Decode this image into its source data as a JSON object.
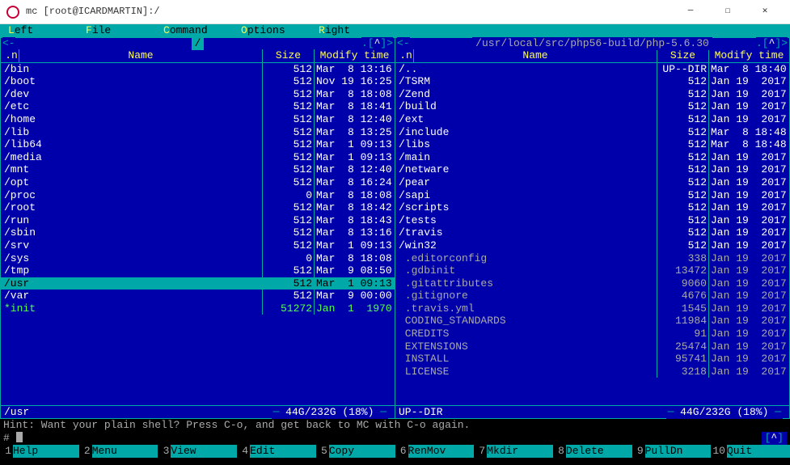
{
  "window": {
    "title": "mc [root@ICARDMARTIN]:/"
  },
  "menubar": {
    "items": [
      {
        "hotkey": "L",
        "rest": "eft"
      },
      {
        "hotkey": "F",
        "rest": "ile"
      },
      {
        "hotkey": "C",
        "rest": "ommand"
      },
      {
        "hotkey": "O",
        "rest": "ptions"
      },
      {
        "hotkey": "R",
        "rest": "ight"
      }
    ]
  },
  "left_panel": {
    "path": " / ",
    "corner_left": "<-",
    "corner_right_pre": ".[",
    "corner_right_caret": "^",
    "corner_right_post": "]>",
    "columns": {
      "dot": ".n",
      "name": "Name",
      "size": "Size",
      "mtime": "Modify time"
    },
    "rows": [
      {
        "name": "/bin",
        "size": "512",
        "date": "Mar  8 13:16",
        "type": "dir"
      },
      {
        "name": "/boot",
        "size": "512",
        "date": "Nov 19 16:25",
        "type": "dir"
      },
      {
        "name": "/dev",
        "size": "512",
        "date": "Mar  8 18:08",
        "type": "dir"
      },
      {
        "name": "/etc",
        "size": "512",
        "date": "Mar  8 18:41",
        "type": "dir"
      },
      {
        "name": "/home",
        "size": "512",
        "date": "Mar  8 12:40",
        "type": "dir"
      },
      {
        "name": "/lib",
        "size": "512",
        "date": "Mar  8 13:25",
        "type": "dir"
      },
      {
        "name": "/lib64",
        "size": "512",
        "date": "Mar  1 09:13",
        "type": "dir"
      },
      {
        "name": "/media",
        "size": "512",
        "date": "Mar  1 09:13",
        "type": "dir"
      },
      {
        "name": "/mnt",
        "size": "512",
        "date": "Mar  8 12:40",
        "type": "dir"
      },
      {
        "name": "/opt",
        "size": "512",
        "date": "Mar  8 16:24",
        "type": "dir"
      },
      {
        "name": "/proc",
        "size": "0",
        "date": "Mar  8 18:08",
        "type": "dir"
      },
      {
        "name": "/root",
        "size": "512",
        "date": "Mar  8 18:42",
        "type": "dir"
      },
      {
        "name": "/run",
        "size": "512",
        "date": "Mar  8 18:43",
        "type": "dir"
      },
      {
        "name": "/sbin",
        "size": "512",
        "date": "Mar  8 13:16",
        "type": "dir"
      },
      {
        "name": "/srv",
        "size": "512",
        "date": "Mar  1 09:13",
        "type": "dir"
      },
      {
        "name": "/sys",
        "size": "0",
        "date": "Mar  8 18:08",
        "type": "dir"
      },
      {
        "name": "/tmp",
        "size": "512",
        "date": "Mar  9 08:50",
        "type": "dir"
      },
      {
        "name": "/usr",
        "size": "512",
        "date": "Mar  1 09:13",
        "type": "dir",
        "selected": true
      },
      {
        "name": "/var",
        "size": "512",
        "date": "Mar  9 00:00",
        "type": "dir"
      },
      {
        "name": "*init",
        "size": "51272",
        "date": "Jan  1  1970",
        "type": "exec"
      }
    ],
    "footer": "/usr",
    "disk": "44G/232G (18%)"
  },
  "right_panel": {
    "path": " /usr/local/src/php56-build/php-5.6.30 ",
    "corner_left": "<-",
    "corner_right_pre": ".[",
    "corner_right_caret": "^",
    "corner_right_post": "]>",
    "columns": {
      "dot": ".n",
      "name": "Name",
      "size": "Size",
      "mtime": "Modify time"
    },
    "rows": [
      {
        "name": "/..",
        "size": "UP--DIR",
        "date": "Mar  8 18:40",
        "type": "dir"
      },
      {
        "name": "/TSRM",
        "size": "512",
        "date": "Jan 19  2017",
        "type": "dir"
      },
      {
        "name": "/Zend",
        "size": "512",
        "date": "Jan 19  2017",
        "type": "dir"
      },
      {
        "name": "/build",
        "size": "512",
        "date": "Jan 19  2017",
        "type": "dir"
      },
      {
        "name": "/ext",
        "size": "512",
        "date": "Jan 19  2017",
        "type": "dir"
      },
      {
        "name": "/include",
        "size": "512",
        "date": "Mar  8 18:48",
        "type": "dir"
      },
      {
        "name": "/libs",
        "size": "512",
        "date": "Mar  8 18:48",
        "type": "dir"
      },
      {
        "name": "/main",
        "size": "512",
        "date": "Jan 19  2017",
        "type": "dir"
      },
      {
        "name": "/netware",
        "size": "512",
        "date": "Jan 19  2017",
        "type": "dir"
      },
      {
        "name": "/pear",
        "size": "512",
        "date": "Jan 19  2017",
        "type": "dir"
      },
      {
        "name": "/sapi",
        "size": "512",
        "date": "Jan 19  2017",
        "type": "dir"
      },
      {
        "name": "/scripts",
        "size": "512",
        "date": "Jan 19  2017",
        "type": "dir"
      },
      {
        "name": "/tests",
        "size": "512",
        "date": "Jan 19  2017",
        "type": "dir"
      },
      {
        "name": "/travis",
        "size": "512",
        "date": "Jan 19  2017",
        "type": "dir"
      },
      {
        "name": "/win32",
        "size": "512",
        "date": "Jan 19  2017",
        "type": "dir"
      },
      {
        "name": " .editorconfig",
        "size": "338",
        "date": "Jan 19  2017",
        "type": "regular"
      },
      {
        "name": " .gdbinit",
        "size": "13472",
        "date": "Jan 19  2017",
        "type": "regular"
      },
      {
        "name": " .gitattributes",
        "size": "9060",
        "date": "Jan 19  2017",
        "type": "regular"
      },
      {
        "name": " .gitignore",
        "size": "4676",
        "date": "Jan 19  2017",
        "type": "regular"
      },
      {
        "name": " .travis.yml",
        "size": "1545",
        "date": "Jan 19  2017",
        "type": "regular"
      },
      {
        "name": " CODING_STANDARDS",
        "size": "11984",
        "date": "Jan 19  2017",
        "type": "regular"
      },
      {
        "name": " CREDITS",
        "size": "91",
        "date": "Jan 19  2017",
        "type": "regular"
      },
      {
        "name": " EXTENSIONS",
        "size": "25474",
        "date": "Jan 19  2017",
        "type": "regular"
      },
      {
        "name": " INSTALL",
        "size": "95741",
        "date": "Jan 19  2017",
        "type": "regular"
      },
      {
        "name": " LICENSE",
        "size": "3218",
        "date": "Jan 19  2017",
        "type": "regular"
      }
    ],
    "footer": "UP--DIR",
    "disk": "44G/232G (18%)"
  },
  "hint": "Hint: Want your plain shell? Press C-o, and get back to MC with C-o again.",
  "prompt": "#",
  "prompt_caret_pre": "[",
  "prompt_caret": "^",
  "prompt_caret_post": "]",
  "fkeys": [
    {
      "n": "1",
      "label": "Help"
    },
    {
      "n": "2",
      "label": "Menu"
    },
    {
      "n": "3",
      "label": "View"
    },
    {
      "n": "4",
      "label": "Edit"
    },
    {
      "n": "5",
      "label": "Copy"
    },
    {
      "n": "6",
      "label": "RenMov"
    },
    {
      "n": "7",
      "label": "Mkdir"
    },
    {
      "n": "8",
      "label": "Delete"
    },
    {
      "n": "9",
      "label": "PullDn"
    },
    {
      "n": "10",
      "label": "Quit"
    }
  ]
}
